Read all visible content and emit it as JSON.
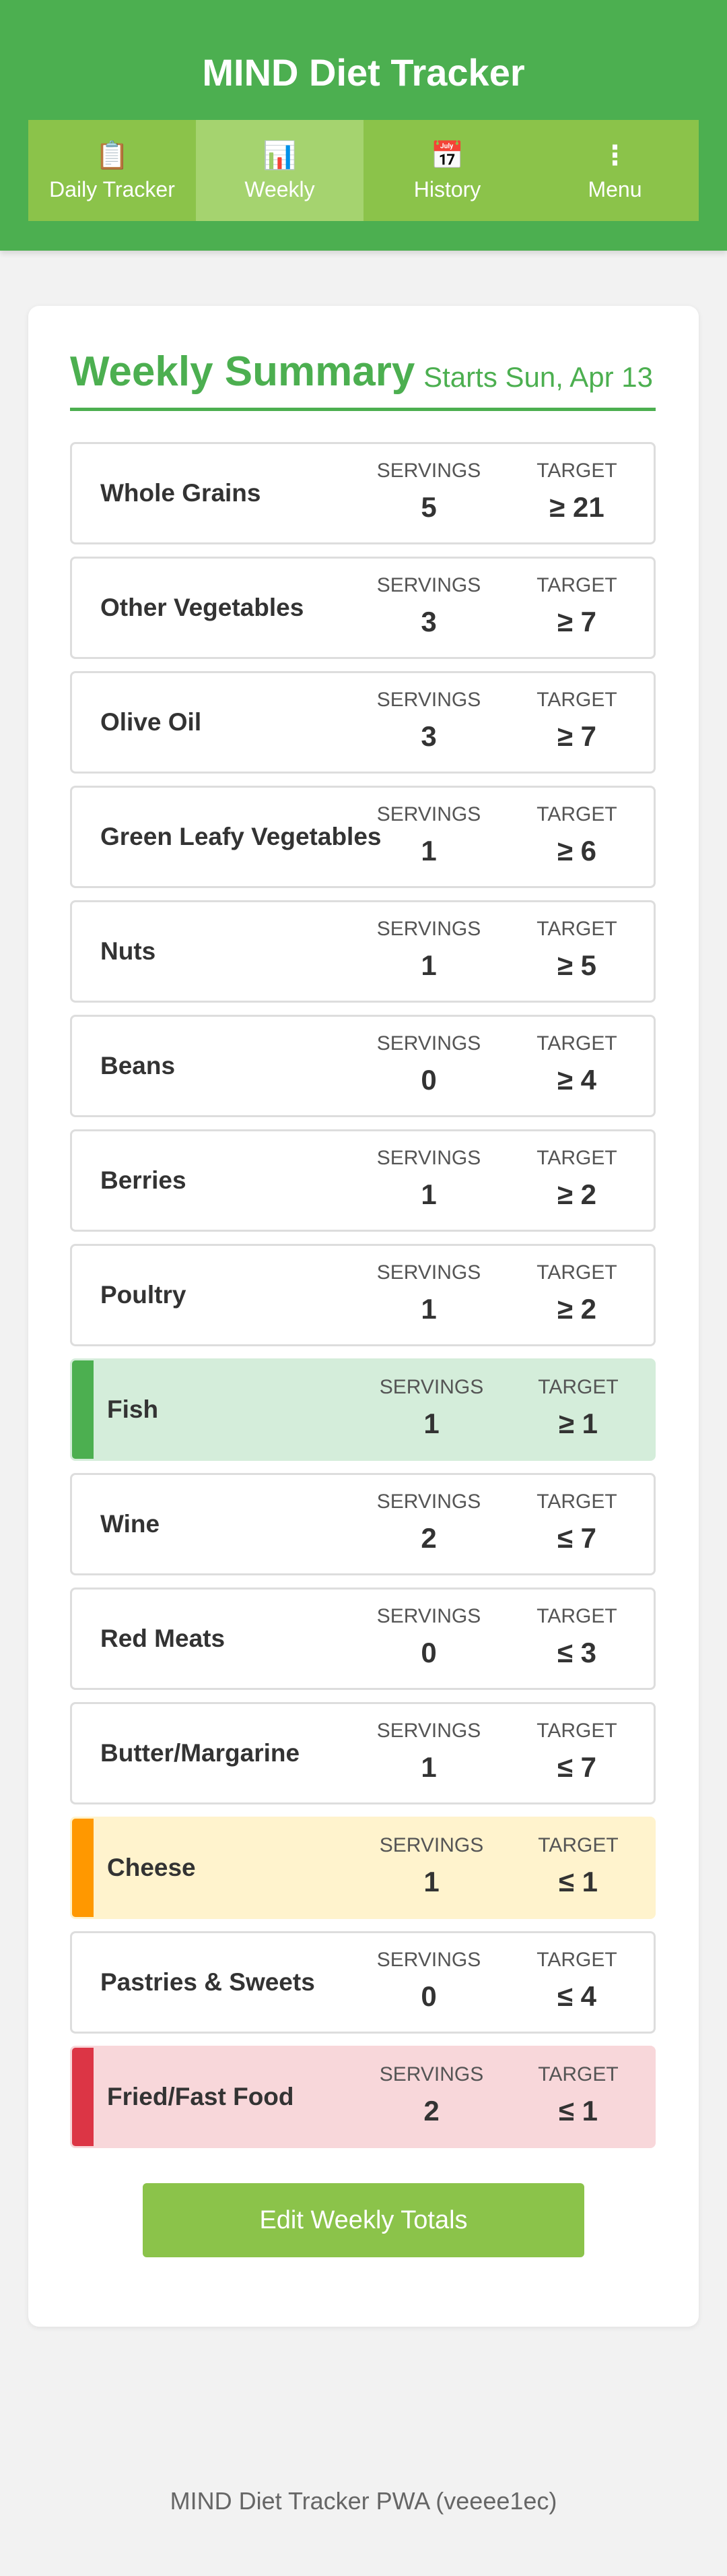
{
  "app": {
    "title": "MIND Diet Tracker"
  },
  "nav": {
    "items": [
      {
        "label": "Daily Tracker",
        "icon": "clipboard-icon",
        "glyph": "📋"
      },
      {
        "label": "Weekly",
        "icon": "bar-chart-icon",
        "glyph": "📊",
        "active": true
      },
      {
        "label": "History",
        "icon": "calendar-icon",
        "glyph": "📅"
      },
      {
        "label": "Menu",
        "icon": "more-vertical-icon",
        "glyph": "⋮"
      }
    ]
  },
  "summary": {
    "title": "Weekly Summary",
    "subtitle": "Starts Sun, Apr 13",
    "servings_label": "SERVINGS",
    "target_label": "TARGET",
    "rows": [
      {
        "name": "Whole Grains",
        "servings": "5",
        "target": "≥ 21",
        "status": ""
      },
      {
        "name": "Other Vegetables",
        "servings": "3",
        "target": "≥ 7",
        "status": ""
      },
      {
        "name": "Olive Oil",
        "servings": "3",
        "target": "≥ 7",
        "status": ""
      },
      {
        "name": "Green Leafy Vegetables",
        "servings": "1",
        "target": "≥ 6",
        "status": ""
      },
      {
        "name": "Nuts",
        "servings": "1",
        "target": "≥ 5",
        "status": ""
      },
      {
        "name": "Beans",
        "servings": "0",
        "target": "≥ 4",
        "status": ""
      },
      {
        "name": "Berries",
        "servings": "1",
        "target": "≥ 2",
        "status": ""
      },
      {
        "name": "Poultry",
        "servings": "1",
        "target": "≥ 2",
        "status": ""
      },
      {
        "name": "Fish",
        "servings": "1",
        "target": "≥ 1",
        "status": "good"
      },
      {
        "name": "Wine",
        "servings": "2",
        "target": "≤ 7",
        "status": ""
      },
      {
        "name": "Red Meats",
        "servings": "0",
        "target": "≤ 3",
        "status": ""
      },
      {
        "name": "Butter/Margarine",
        "servings": "1",
        "target": "≤ 7",
        "status": ""
      },
      {
        "name": "Cheese",
        "servings": "1",
        "target": "≤ 1",
        "status": "warn"
      },
      {
        "name": "Pastries & Sweets",
        "servings": "0",
        "target": "≤ 4",
        "status": ""
      },
      {
        "name": "Fried/Fast Food",
        "servings": "2",
        "target": "≤ 1",
        "status": "bad"
      }
    ],
    "edit_button": "Edit Weekly Totals"
  },
  "colors": {
    "primary": "#4caf50",
    "accent": "#8bc34a",
    "good": "#4caf50",
    "warn": "#ff9800",
    "bad": "#dc3545"
  },
  "footer": {
    "text": "MIND Diet Tracker PWA (veeee1ec)"
  }
}
